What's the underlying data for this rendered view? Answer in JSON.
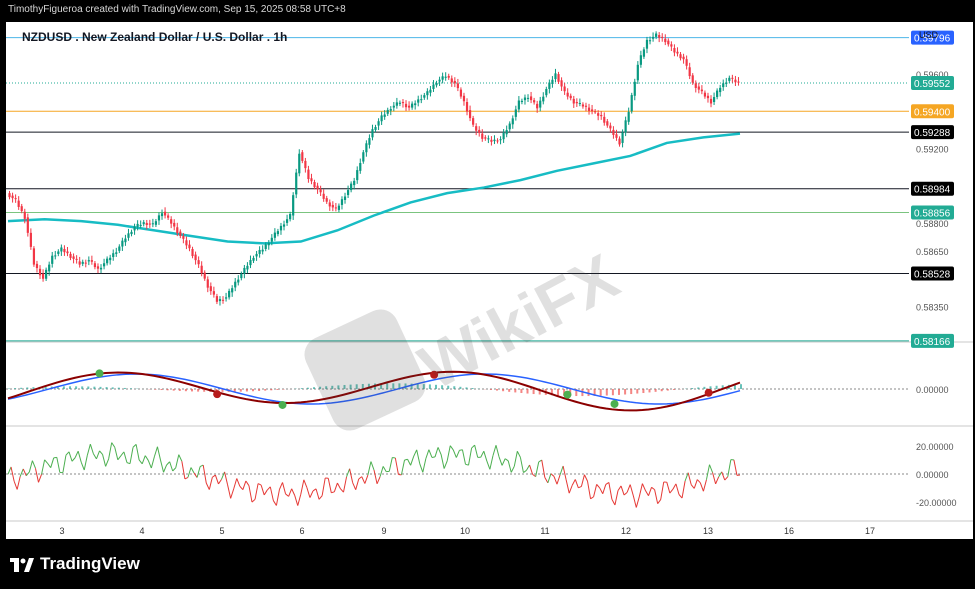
{
  "caption": "TimothyFigueroa created with TradingView.com, Sep 15, 2025 08:58 UTC+8",
  "footer_brand": "TradingView",
  "watermark": "WikiFX",
  "chart_data": {
    "type": "candlestick",
    "title": "NZDUSD . New Zealand Dollar / U.S. Dollar . 1h",
    "currency": "USD",
    "x_ticks": [
      "3",
      "4",
      "5",
      "6",
      "9",
      "10",
      "11",
      "12",
      "13",
      "16",
      "17"
    ],
    "price_axis_ticks": [
      "0.59600",
      "0.59200",
      "0.58800",
      "0.58650",
      "0.58350"
    ],
    "last_price": "0.59552",
    "price_ylim": [
      0.5816,
      0.5988
    ],
    "horizontal_levels": [
      {
        "value": "0.59796",
        "color": "#2962ff",
        "line": "#4db6e8"
      },
      {
        "value": "0.59400",
        "color": "#f5a623",
        "line": "#f5a623"
      },
      {
        "value": "0.59288",
        "color": "#000000",
        "line": "#ffffff"
      },
      {
        "value": "0.58984",
        "color": "#000000",
        "line": "#ffffff"
      },
      {
        "value": "0.58856",
        "color": "#22ab94",
        "line": "#7bc47f"
      },
      {
        "value": "0.58528",
        "color": "#000000",
        "line": "#ffffff"
      },
      {
        "value": "0.58166",
        "color": "#22ab94",
        "line": "#22ab94"
      }
    ],
    "price_path": [
      [
        0,
        0.5896
      ],
      [
        3,
        0.5892
      ],
      [
        6,
        0.5883
      ],
      [
        9,
        0.5858
      ],
      [
        12,
        0.585
      ],
      [
        15,
        0.5862
      ],
      [
        18,
        0.5866
      ],
      [
        21,
        0.5862
      ],
      [
        24,
        0.5858
      ],
      [
        27,
        0.586
      ],
      [
        30,
        0.5855
      ],
      [
        33,
        0.586
      ],
      [
        36,
        0.5865
      ],
      [
        39,
        0.5872
      ],
      [
        42,
        0.5878
      ],
      [
        45,
        0.588
      ],
      [
        48,
        0.5879
      ],
      [
        51,
        0.5886
      ],
      [
        54,
        0.588
      ],
      [
        57,
        0.5873
      ],
      [
        60,
        0.5866
      ],
      [
        63,
        0.5857
      ],
      [
        66,
        0.5846
      ],
      [
        69,
        0.5838
      ],
      [
        72,
        0.584
      ],
      [
        75,
        0.5848
      ],
      [
        78,
        0.5855
      ],
      [
        81,
        0.5862
      ],
      [
        84,
        0.5866
      ],
      [
        87,
        0.5872
      ],
      [
        90,
        0.5878
      ],
      [
        93,
        0.5884
      ],
      [
        96,
        0.5918
      ],
      [
        99,
        0.5904
      ],
      [
        102,
        0.5898
      ],
      [
        105,
        0.5891
      ],
      [
        108,
        0.5887
      ],
      [
        111,
        0.5895
      ],
      [
        114,
        0.5903
      ],
      [
        117,
        0.5918
      ],
      [
        120,
        0.593
      ],
      [
        123,
        0.5937
      ],
      [
        126,
        0.5942
      ],
      [
        129,
        0.5945
      ],
      [
        132,
        0.5942
      ],
      [
        135,
        0.5946
      ],
      [
        138,
        0.595
      ],
      [
        141,
        0.5956
      ],
      [
        144,
        0.5959
      ],
      [
        147,
        0.5955
      ],
      [
        150,
        0.5945
      ],
      [
        153,
        0.5932
      ],
      [
        156,
        0.5926
      ],
      [
        159,
        0.5924
      ],
      [
        162,
        0.5925
      ],
      [
        165,
        0.5933
      ],
      [
        168,
        0.5945
      ],
      [
        171,
        0.5948
      ],
      [
        174,
        0.5942
      ],
      [
        177,
        0.5952
      ],
      [
        180,
        0.596
      ],
      [
        183,
        0.595
      ],
      [
        186,
        0.5945
      ],
      [
        189,
        0.5943
      ],
      [
        192,
        0.594
      ],
      [
        195,
        0.5937
      ],
      [
        198,
        0.593
      ],
      [
        201,
        0.5923
      ],
      [
        204,
        0.594
      ],
      [
        207,
        0.5965
      ],
      [
        210,
        0.5978
      ],
      [
        213,
        0.5981
      ],
      [
        216,
        0.5978
      ],
      [
        219,
        0.5972
      ],
      [
        222,
        0.5968
      ],
      [
        225,
        0.5955
      ],
      [
        228,
        0.595
      ],
      [
        231,
        0.5945
      ],
      [
        234,
        0.5953
      ],
      [
        237,
        0.5958
      ],
      [
        240,
        0.5955
      ]
    ],
    "ma_path": [
      [
        0,
        0.5881
      ],
      [
        12,
        0.5882
      ],
      [
        24,
        0.5881
      ],
      [
        36,
        0.5879
      ],
      [
        48,
        0.5876
      ],
      [
        60,
        0.5873
      ],
      [
        72,
        0.587
      ],
      [
        84,
        0.5869
      ],
      [
        96,
        0.587
      ],
      [
        108,
        0.5876
      ],
      [
        120,
        0.5884
      ],
      [
        132,
        0.5891
      ],
      [
        144,
        0.5896
      ],
      [
        156,
        0.5899
      ],
      [
        168,
        0.5903
      ],
      [
        180,
        0.5908
      ],
      [
        192,
        0.5912
      ],
      [
        204,
        0.5916
      ],
      [
        216,
        0.5923
      ],
      [
        228,
        0.5926
      ],
      [
        240,
        0.5928
      ]
    ],
    "macd_axis_ticks": [
      "0.00000"
    ],
    "rsi_axis_ticks": [
      "20.00000",
      "0.00000",
      "-20.00000"
    ]
  }
}
